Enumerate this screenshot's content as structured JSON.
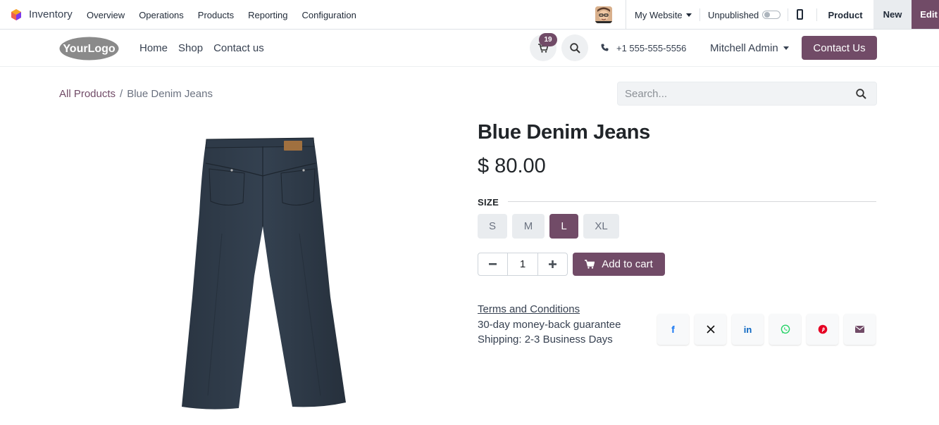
{
  "topbar": {
    "app_name": "Inventory",
    "menu": [
      "Overview",
      "Operations",
      "Products",
      "Reporting",
      "Configuration"
    ],
    "website_selector": "My Website",
    "publish_label": "Unpublished",
    "product_tab": "Product",
    "new_label": "New",
    "edit_label": "Edit"
  },
  "header": {
    "logo_text": "YourLogo",
    "nav": [
      "Home",
      "Shop",
      "Contact us"
    ],
    "cart_count": "19",
    "phone": "+1 555-555-5556",
    "user": "Mitchell Admin",
    "contact_button": "Contact Us"
  },
  "breadcrumb": {
    "root": "All Products",
    "separator": "/",
    "current": "Blue Denim Jeans"
  },
  "search": {
    "placeholder": "Search..."
  },
  "product": {
    "name": "Blue Denim Jeans",
    "price": "$ 80.00",
    "attribute_label": "SIZE",
    "sizes": [
      "S",
      "M",
      "L",
      "XL"
    ],
    "selected_size": "L",
    "quantity": "1",
    "add_to_cart": "Add to cart",
    "terms": "Terms and Conditions",
    "guarantee": "30-day money-back guarantee",
    "shipping": "Shipping: 2-3 Business Days"
  },
  "share": [
    {
      "icon": "facebook-icon",
      "glyph": "f",
      "color": "#1877f2"
    },
    {
      "icon": "x-twitter-icon",
      "glyph": "𝕏",
      "color": "#111111"
    },
    {
      "icon": "linkedin-icon",
      "glyph": "in",
      "color": "#0a66c2"
    },
    {
      "icon": "whatsapp-icon",
      "glyph": "✆",
      "color": "#25d366"
    },
    {
      "icon": "pinterest-icon",
      "glyph": "P",
      "color": "#e60023"
    },
    {
      "icon": "envelope-icon",
      "glyph": "✉",
      "color": "#714b67"
    }
  ],
  "colors": {
    "brand": "#714b67"
  }
}
